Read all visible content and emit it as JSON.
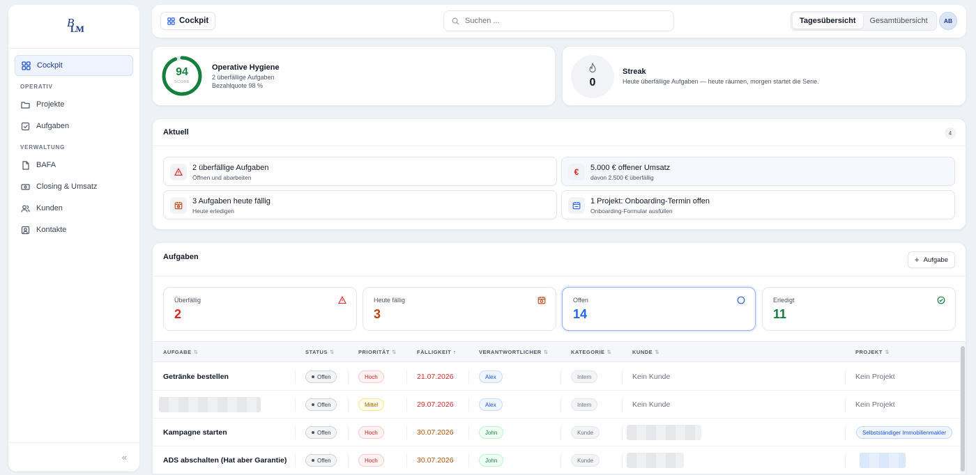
{
  "sidebar": {
    "items": [
      {
        "label": "Cockpit",
        "icon": "grid-icon"
      },
      {
        "label": "Projekte",
        "icon": "folder-icon"
      },
      {
        "label": "Aufgaben",
        "icon": "checkbox-icon"
      },
      {
        "label": "BAFA",
        "icon": "document-icon"
      },
      {
        "label": "Closing & Umsatz",
        "icon": "banknote-icon"
      },
      {
        "label": "Kunden",
        "icon": "users-icon"
      },
      {
        "label": "Kontakte",
        "icon": "contact-icon"
      }
    ],
    "sections": {
      "operativ": "OPERATIV",
      "verwaltung": "VERWALTUNG"
    },
    "collapse_label": "«"
  },
  "header": {
    "breadcrumb": "Cockpit",
    "search_placeholder": "Suchen ...",
    "view_toggle": [
      "Tagesübersicht",
      "Gesamtübersicht"
    ],
    "avatar": "AB"
  },
  "hygiene": {
    "score": "94",
    "score_value": 0.94,
    "score_label": "SCORE",
    "title": "Operative Hygiene",
    "line1": "2 überfällige Aufgaben",
    "line2": "Bezahlquote 98 %"
  },
  "streak": {
    "value": "0",
    "title": "Streak",
    "desc": "Heute überfällige Aufgaben — heute räumen, morgen startet die Serie."
  },
  "aktuell": {
    "title": "Aktuell",
    "count": "4",
    "alerts": [
      {
        "title": "2 überfällige Aufgaben",
        "sub": "Öffnen und abarbeiten",
        "icon": "warning-triangle-icon"
      },
      {
        "title": "5.000 € offener Umsatz",
        "sub": "davon 2.500 € überfällig",
        "icon": "euro-icon"
      },
      {
        "title": "3 Aufgaben heute fällig",
        "sub": "Heute erledigen",
        "icon": "calendar-clock-icon"
      },
      {
        "title": "1 Projekt: Onboarding-Termin offen",
        "sub": "Onboarding-Formular ausfüllen",
        "icon": "calendar-icon"
      }
    ]
  },
  "aufgaben": {
    "title": "Aufgaben",
    "add_label": "Aufgabe",
    "stats": [
      {
        "label": "Überfällig",
        "value": "2",
        "color": "#dc2626"
      },
      {
        "label": "Heute fällig",
        "value": "3",
        "color": "#c2410c"
      },
      {
        "label": "Offen",
        "value": "14",
        "color": "#2563eb"
      },
      {
        "label": "Erledigt",
        "value": "11",
        "color": "#15803d"
      }
    ],
    "columns": [
      "AUFGABE",
      "STATUS",
      "PRIORITÄT",
      "FÄLLIGKEIT",
      "VERANTWORTLICHER",
      "KATEGORIE",
      "KUNDE",
      "PROJEKT"
    ],
    "rows": [
      {
        "task": "Getränke bestellen",
        "status": "Offen",
        "prio": "Hoch",
        "due": "21.07.2026",
        "owner": "Alex",
        "kat": "Intern",
        "kunde": "Kein Kunde",
        "projekt": "Kein Projekt"
      },
      {
        "task": "",
        "status": "Offen",
        "prio": "Mittel",
        "due": "29.07.2026",
        "owner": "Alex",
        "kat": "Intern",
        "kunde": "Kein Kunde",
        "projekt": "Kein Projekt"
      },
      {
        "task": "Kampagne starten",
        "status": "Offen",
        "prio": "Hoch",
        "due": "30.07.2026",
        "owner": "John",
        "kat": "Kunde",
        "kunde": "",
        "projekt": "Selbstständiger Immobilienmakler"
      },
      {
        "task": "ADS abschalten (Hat aber Garantie)",
        "status": "Offen",
        "prio": "Hoch",
        "due": "30.07.2026",
        "owner": "John",
        "kat": "Kunde",
        "kunde": "",
        "projekt": ""
      }
    ]
  }
}
